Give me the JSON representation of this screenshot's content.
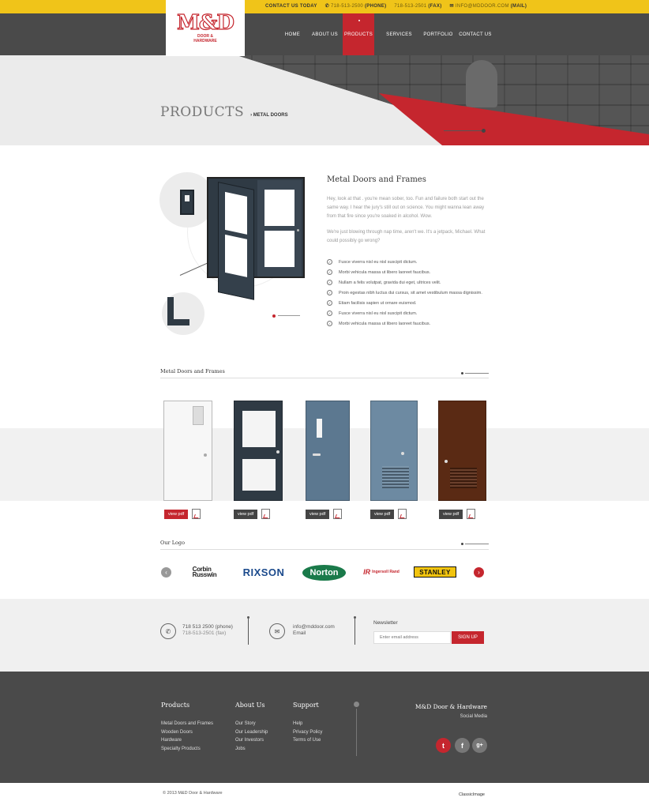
{
  "topbar": {
    "contact_label": "CONTACT US TODAY",
    "phone": "718-513-2500",
    "phone_tag": "(PHONE)",
    "fax": "718-513-2501",
    "fax_tag": "(FAX)",
    "email": "INFO@MDDOOR.COM",
    "email_tag": "(MAIL)"
  },
  "logo": {
    "mark": "M&D",
    "sub_line1": "DOOR &",
    "sub_line2": "HARDWARE"
  },
  "nav": [
    "HOME",
    "ABOUT US",
    "PRODUCTS",
    "SERVICES",
    "PORTFOLIO",
    "CONTACT US"
  ],
  "hero": {
    "title": "PRODUCTS",
    "crumb_sep": "›",
    "crumb": "METAL DOORS"
  },
  "intro": {
    "title": "Metal Doors and Frames",
    "para1": "Hey, look at that . you're mean sober, too. Fun and failure both start out the same way. I hear the jury's still out on science. You might wanna lean away from that fire since you're soaked in alcohol. Wow.",
    "para2": "We're just blowing through nap time, aren't we. It's a jetpack, Michael. What could possibly go wrong?",
    "bullets": [
      "Fusce viverra nisl eu nisl suscipit dictum.",
      "Morbi vehicula massa ut libero laoreet faucibus.",
      "Nullam a felis volutpat, gravida dui eget, ultrices velit.",
      "Proin egestas nibh luctus dui cursus, sit amet vestibulum massa dignissim.",
      "Etiam facilisis sapien ut ornare euismod.",
      "Fusce viverra nisl eu nisl suscipit dictum.",
      "Morbi vehicula massa ut libero laoreet faucibus."
    ]
  },
  "products": {
    "heading": "Metal Doors and Frames",
    "button_label": "view pdf"
  },
  "logos": {
    "heading": "Our Logo",
    "corbin1": "Corbin",
    "corbin2": "Russwin",
    "rixson": "RIXSON",
    "norton": "Norton",
    "ir_mark": "IR",
    "ir": "Ingersoll Rand",
    "stanley": "STANLEY"
  },
  "contact": {
    "phone": "718 513 2500 (phone)",
    "fax": "718-513-2501 (fax)",
    "email": "info@mddoor.com",
    "email_label": "Email",
    "newsletter_title": "Newsletter",
    "newsletter_placeholder": "Enter email address",
    "signup": "SIGN UP"
  },
  "footer": {
    "products_title": "Products",
    "products": [
      "Metal Doors and Frames",
      "Wooden Doors",
      "Hardware",
      "Specialty Products"
    ],
    "about_title": "About Us",
    "about": [
      "Our Story",
      "Our Leadership",
      "Our Investors",
      "Jobs"
    ],
    "support_title": "Support",
    "support": [
      "Help",
      "Privacy Policy",
      "Terms of Use"
    ],
    "brand": "M&D Door & Hardware",
    "social_label": "Social Media",
    "twitter": "t",
    "facebook": "f",
    "gplus": "g+",
    "copyright": "© 2013 M&D Door & Hardware",
    "credit": "ClassicImage"
  },
  "colors": {
    "accent": "#c5262e",
    "topbar": "#f0c419",
    "header": "#4a4a4a"
  },
  "icons": {
    "phone": "phone-icon",
    "email": "envelope-icon",
    "check": "check-circle-icon",
    "pdf": "pdf-icon"
  }
}
